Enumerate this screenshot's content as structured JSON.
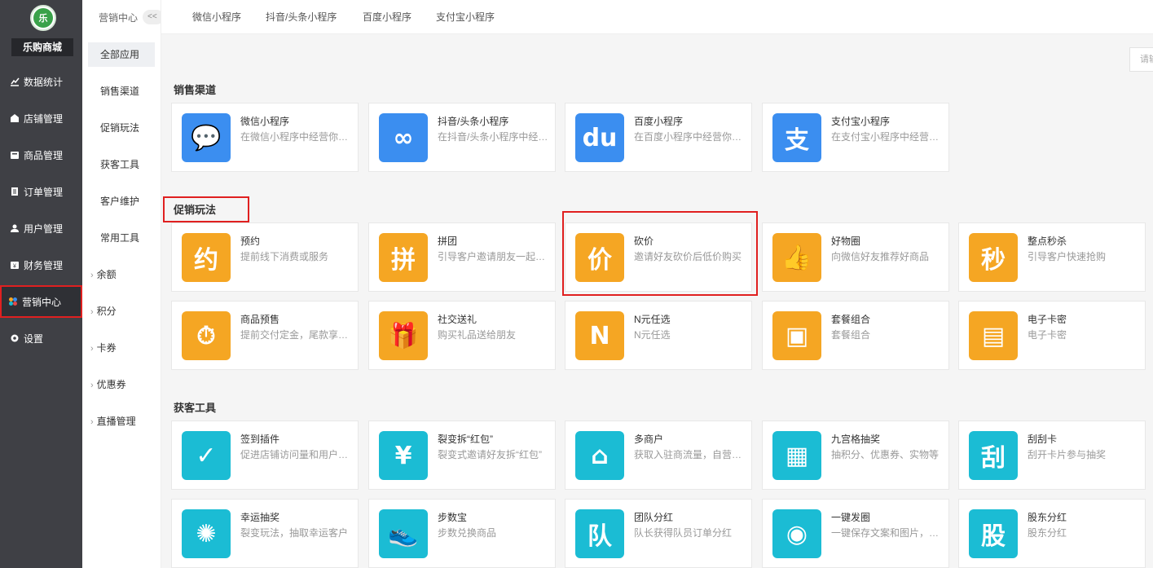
{
  "colors": {
    "blue": "#3b8ef0",
    "orange": "#f5a623",
    "cyan": "#1bbcd4",
    "sidebar": "#3f4045",
    "highlight": "#e02020"
  },
  "app": {
    "logo_text": "乐",
    "shop_name": "乐购商城"
  },
  "nav": [
    {
      "label": "数据统计",
      "icon": "chart-icon"
    },
    {
      "label": "店铺管理",
      "icon": "shop-icon"
    },
    {
      "label": "商品管理",
      "icon": "goods-icon"
    },
    {
      "label": "订单管理",
      "icon": "order-icon"
    },
    {
      "label": "用户管理",
      "icon": "user-icon"
    },
    {
      "label": "财务管理",
      "icon": "wallet-icon"
    },
    {
      "label": "营销中心",
      "icon": "marketing-icon",
      "active": true
    },
    {
      "label": "设置",
      "icon": "gear-icon"
    }
  ],
  "subnav": {
    "title": "营销中心",
    "collapse_label": "<<",
    "items": [
      {
        "label": "全部应用",
        "active": true
      },
      {
        "label": "销售渠道"
      },
      {
        "label": "促销玩法"
      },
      {
        "label": "获客工具"
      },
      {
        "label": "客户维护"
      },
      {
        "label": "常用工具"
      },
      {
        "label": "余额",
        "arrow": true
      },
      {
        "label": "积分",
        "arrow": true
      },
      {
        "label": "卡券",
        "arrow": true
      },
      {
        "label": "优惠券",
        "arrow": true
      },
      {
        "label": "直播管理",
        "arrow": true
      }
    ]
  },
  "top_tabs": [
    "微信小程序",
    "抖音/头条小程序",
    "百度小程序",
    "支付宝小程序"
  ],
  "search": {
    "placeholder": "请输"
  },
  "sections": {
    "channels": {
      "title": "销售渠道",
      "cards": [
        {
          "title": "微信小程序",
          "desc": "在微信小程序中经营你的店铺",
          "icon": "wechat-icon",
          "glyph": "💬"
        },
        {
          "title": "抖音/头条小程序",
          "desc": "在抖音/头条小程序中经营你的店铺",
          "icon": "douyin-icon",
          "glyph": "∞"
        },
        {
          "title": "百度小程序",
          "desc": "在百度小程序中经营你的店铺",
          "icon": "baidu-icon",
          "glyph": "du"
        },
        {
          "title": "支付宝小程序",
          "desc": "在支付宝小程序中经营你的店铺",
          "icon": "alipay-icon",
          "glyph": "支"
        }
      ]
    },
    "promotion": {
      "title": "促销玩法",
      "cards": [
        {
          "title": "预约",
          "desc": "提前线下消费或服务",
          "icon": "reserve-icon",
          "glyph": "约"
        },
        {
          "title": "拼团",
          "desc": "引导客户邀请朋友一起拼团购买",
          "icon": "group-buy-icon",
          "glyph": "拼"
        },
        {
          "title": "砍价",
          "desc": "邀请好友砍价后低价购买",
          "icon": "bargain-icon",
          "glyph": "价"
        },
        {
          "title": "好物圈",
          "desc": "向微信好友推荐好商品",
          "icon": "thumb-icon",
          "glyph": "👍"
        },
        {
          "title": "整点秒杀",
          "desc": "引导客户快速抢购",
          "icon": "flash-sale-icon",
          "glyph": "秒"
        },
        {
          "title": "商品预售",
          "desc": "提前交付定金，尾款享受优惠",
          "icon": "presale-icon",
          "glyph": "⏱"
        },
        {
          "title": "社交送礼",
          "desc": "购买礼品送给朋友",
          "icon": "gift-icon",
          "glyph": "🎁"
        },
        {
          "title": "N元任选",
          "desc": "N元任选",
          "icon": "n-choice-icon",
          "glyph": "N"
        },
        {
          "title": "套餐组合",
          "desc": "套餐组合",
          "icon": "combo-icon",
          "glyph": "▣"
        },
        {
          "title": "电子卡密",
          "desc": "电子卡密",
          "icon": "card-key-icon",
          "glyph": "▤"
        }
      ]
    },
    "acquire": {
      "title": "获客工具",
      "cards": [
        {
          "title": "签到插件",
          "desc": "促进店铺访问量和用户活跃度",
          "icon": "checkin-icon",
          "glyph": "✓"
        },
        {
          "title": "裂变拆“红包”",
          "desc": "裂变式邀请好友拆“红包”",
          "icon": "redpacket-icon",
          "glyph": "¥"
        },
        {
          "title": "多商户",
          "desc": "获取入驻商流量，自营商户",
          "icon": "store-icon",
          "glyph": "⌂"
        },
        {
          "title": "九宫格抽奖",
          "desc": "抽积分、优惠券、实物等",
          "icon": "grid-lottery-icon",
          "glyph": "▦"
        },
        {
          "title": "刮刮卡",
          "desc": "刮开卡片参与抽奖",
          "icon": "scratch-card-icon",
          "glyph": "刮"
        },
        {
          "title": "幸运抽奖",
          "desc": "裂变玩法，抽取幸运客户",
          "icon": "wheel-icon",
          "glyph": "✺"
        },
        {
          "title": "步数宝",
          "desc": "步数兑换商品",
          "icon": "shoe-icon",
          "glyph": "👟"
        },
        {
          "title": "团队分红",
          "desc": "队长获得队员订单分红",
          "icon": "team-icon",
          "glyph": "队"
        },
        {
          "title": "一键发圈",
          "desc": "一键保存文案和图片，分享朋友圈",
          "icon": "moments-icon",
          "glyph": "◉"
        },
        {
          "title": "股东分红",
          "desc": "股东分红",
          "icon": "shareholder-icon",
          "glyph": "股"
        }
      ]
    }
  }
}
